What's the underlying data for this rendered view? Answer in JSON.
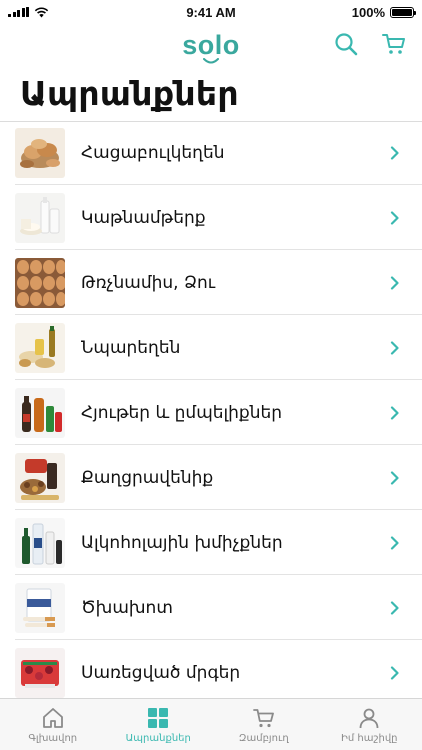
{
  "status_bar": {
    "time": "9:41 AM",
    "battery": "100%"
  },
  "header": {
    "logo": "solo",
    "search_icon": "search-icon",
    "cart_icon": "cart-icon"
  },
  "page": {
    "title": "Ապրանքներ"
  },
  "categories": [
    {
      "label": "Հացաբուլկեղեն",
      "icon": "bread-thumbnail"
    },
    {
      "label": "Կաթնամթերք",
      "icon": "dairy-thumbnail"
    },
    {
      "label": "Թռչնամիս, Ձու",
      "icon": "eggs-thumbnail"
    },
    {
      "label": "Նպարեղեն",
      "icon": "grocery-thumbnail"
    },
    {
      "label": "Հյութեր և ըմպելիքներ",
      "icon": "drinks-thumbnail"
    },
    {
      "label": "Քաղցրավենիք",
      "icon": "sweets-thumbnail"
    },
    {
      "label": "Ալկոհոլային խմիչքներ",
      "icon": "alcohol-thumbnail"
    },
    {
      "label": "Ծխախոտ",
      "icon": "tobacco-thumbnail"
    },
    {
      "label": "Սառեցված մրգեր",
      "icon": "frozen-fruit-thumbnail"
    }
  ],
  "tab_bar": {
    "tabs": [
      {
        "label": "Գլխավոր",
        "icon": "home-icon"
      },
      {
        "label": "Ապրանքներ",
        "icon": "grid-icon"
      },
      {
        "label": "Զամբյուղ",
        "icon": "cart-icon"
      },
      {
        "label": "Իմ հաշիվը",
        "icon": "user-icon"
      }
    ],
    "active_index": 1
  },
  "colors": {
    "accent": "#3ab8b0",
    "logo": "#3aa89e"
  }
}
